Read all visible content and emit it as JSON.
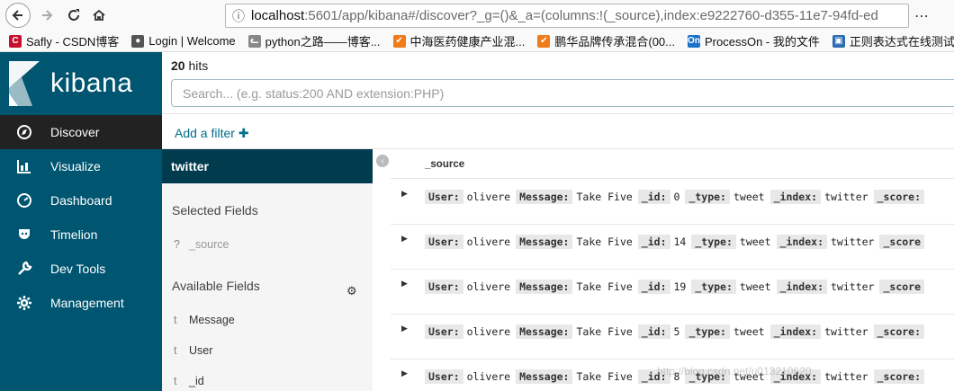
{
  "browser": {
    "url_host": "localhost",
    "url_path": ":5601/app/kibana#/discover?_g=()&_a=(columns:!(_source),index:e9222760-d355-11e7-94fd-ed",
    "bookmarks": [
      {
        "label": "Safly - CSDN博客",
        "color": "#c8102e",
        "glyph": "C"
      },
      {
        "label": "Login | Welcome",
        "color": "#555555",
        "glyph": "●"
      },
      {
        "label": "python之路——博客...",
        "color": "#888888",
        "glyph": "ᓚ"
      },
      {
        "label": "中海医药健康产业混...",
        "color": "#f07b1a",
        "glyph": "✔"
      },
      {
        "label": "鹏华品牌传承混合(00...",
        "color": "#f07b1a",
        "glyph": "✔"
      },
      {
        "label": "ProcessOn - 我的文件",
        "color": "#1a73c9",
        "glyph": "On"
      },
      {
        "label": "正则表达式在线测试 -",
        "color": "#2b6cb0",
        "glyph": "▣"
      }
    ]
  },
  "kibana": {
    "logo_text": "kibana",
    "nav": [
      {
        "label": "Discover",
        "icon": "compass-icon",
        "active": true
      },
      {
        "label": "Visualize",
        "icon": "bar-chart-icon",
        "active": false
      },
      {
        "label": "Dashboard",
        "icon": "dashboard-icon",
        "active": false
      },
      {
        "label": "Timelion",
        "icon": "timelion-icon",
        "active": false
      },
      {
        "label": "Dev Tools",
        "icon": "wrench-icon",
        "active": false
      },
      {
        "label": "Management",
        "icon": "gear-icon",
        "active": false
      }
    ]
  },
  "discover": {
    "hits_count": "20",
    "hits_label": "hits",
    "search_placeholder": "Search... (e.g. status:200 AND extension:PHP)",
    "add_filter": "Add a filter",
    "index_pattern": "twitter",
    "selected_fields_title": "Selected Fields",
    "selected_fields": [
      {
        "type": "?",
        "name": "_source"
      }
    ],
    "available_fields_title": "Available Fields",
    "available_fields": [
      {
        "type": "t",
        "name": "Message"
      },
      {
        "type": "t",
        "name": "User"
      },
      {
        "type": "t",
        "name": "_id"
      }
    ],
    "column_header": "_source",
    "rows": [
      {
        "user": "olivere",
        "message": "Take Five",
        "id": "0",
        "type": "tweet",
        "index": "twitter",
        "score_label": "_score:"
      },
      {
        "user": "olivere",
        "message": "Take Five",
        "id": "14",
        "type": "tweet",
        "index": "twitter",
        "score_label": "_score"
      },
      {
        "user": "olivere",
        "message": "Take Five",
        "id": "19",
        "type": "tweet",
        "index": "twitter",
        "score_label": "_score"
      },
      {
        "user": "olivere",
        "message": "Take Five",
        "id": "5",
        "type": "tweet",
        "index": "twitter",
        "score_label": "_score:"
      },
      {
        "user": "olivere",
        "message": "Take Five",
        "id": "8",
        "type": "tweet",
        "index": "twitter",
        "score_label": "_score:"
      }
    ],
    "labels": {
      "user": "User:",
      "message": "Message:",
      "id": "_id:",
      "type": "_type:",
      "index": "_index:"
    }
  },
  "watermark": "http://blog.csdn.net/u013210620"
}
